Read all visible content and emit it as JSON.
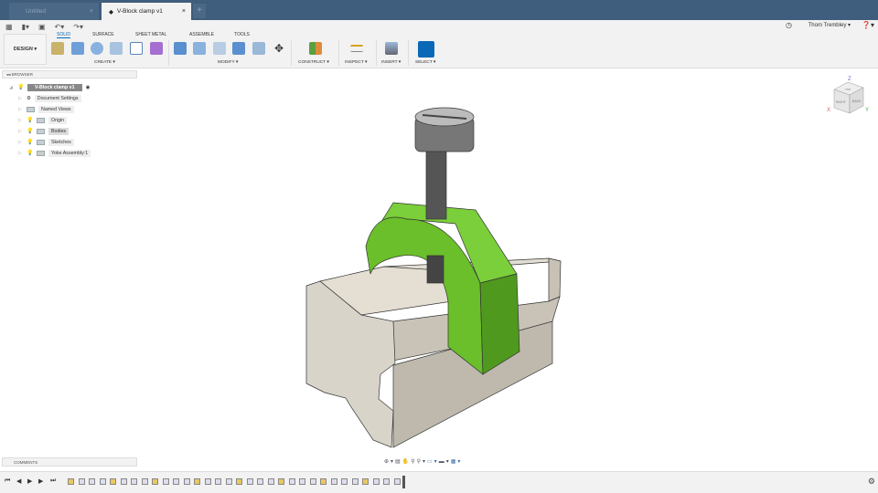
{
  "tabs": [
    {
      "label": "Untitled",
      "active": false
    },
    {
      "label": "V-Block clamp v1",
      "active": true
    }
  ],
  "user": "Thom Trembley ▾",
  "workspace": "DESIGN ▾",
  "ribbon_tabs": [
    "SOLID",
    "SURFACE",
    "SHEET METAL",
    "ASSEMBLE",
    "TOOLS"
  ],
  "groups": {
    "create": "CREATE ▾",
    "modify": "MODIFY ▾",
    "construct": "CONSTRUCT ▾",
    "inspect": "INSPECT ▾",
    "insert": "INSERT ▾",
    "select": "SELECT ▾"
  },
  "browser": {
    "title": "BROWSER",
    "root": "V-Block clamp v1",
    "items": [
      "Document Settings",
      "Named Views",
      "Origin",
      "Bodies",
      "Sketches",
      "Yoke Assembly:1"
    ]
  },
  "comments": "COMMENTS",
  "viewcube": {
    "top": "TOP",
    "right": "RIGHT",
    "back": "BACK",
    "x": "X",
    "y": "Y",
    "z": "Z"
  },
  "colors": {
    "titlebar": "#3f5d7c",
    "accent": "#0a69b7",
    "yoke": "#6bbf2a",
    "block": "#d8d3c8"
  }
}
